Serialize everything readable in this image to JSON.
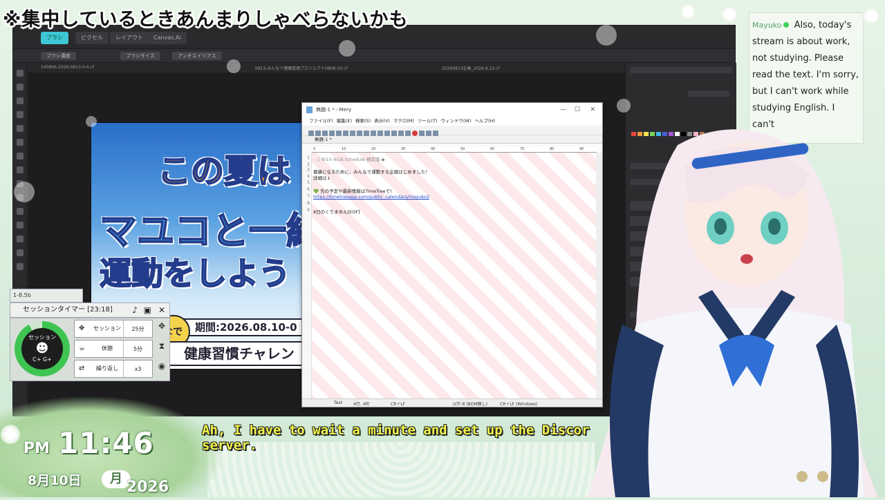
{
  "banner_text": "※集中しているときあんまりしゃべらないかも",
  "painter": {
    "tabs": [
      "ブラシ",
      "ピクセル",
      "レイアウト",
      "Canvas.Ai"
    ],
    "options": [
      "ブラシ濃度",
      "ブラシサイズ",
      "アンチエイリアス"
    ],
    "doc_tabs": [
      "240806-2026-0813-0-4.cf",
      "0813.みんなで健康管理プロジェクト0808-00.cf",
      "20260813企画_2026.8.10.cf"
    ],
    "swatch_colors": [
      "#e8453c",
      "#f19a3e",
      "#f6e24c",
      "#7ad15a",
      "#3cb4e5",
      "#4a60d8",
      "#a45ad6",
      "#ffffff",
      "#000000",
      "#888888",
      "#f6b8c8",
      "#b87b52"
    ]
  },
  "poster": {
    "line1": "この夏は",
    "line2": "マユコと一緒",
    "line3": "運動をしよう",
    "badge": "期間:2026.08.10-0",
    "sub": "健康習慣チャレン",
    "circle_text": "なで"
  },
  "mery": {
    "title": "無題-1 * - Mery",
    "menu": [
      "ファイル(F)",
      "編集(E)",
      "検索(S)",
      "表示(V)",
      "マクロ(M)",
      "ツール(T)",
      "ウィンドウ(W)",
      "ヘルプ(H)"
    ],
    "doc_tab": "無題-1 *",
    "ruler": [
      "0",
      "10",
      "20",
      "30",
      "40",
      "50",
      "60",
      "70",
      "80",
      "90"
    ],
    "line_numbers": [
      "1",
      "2",
      "3",
      "4",
      "5",
      "6",
      "7",
      "8",
      "9"
    ],
    "lines": [
      "- ○ 8/10-8/16 schedule 検定版 ◆",
      "",
      "健康になるために、みんなで運動する企画はじめました！",
      "詳細は↓",
      "",
      "💚 先の予定や最新情報はTimeTreeで！",
      "https://timetreeapp.com/public_calendars/mayuko2",
      "",
      "8日のくりまゆん[EOF]"
    ],
    "status": {
      "mode": "Text",
      "pos": "4行, 4桁",
      "eol": "CR＋LF",
      "encoding": "UTF-8 (BOM無し)",
      "eol2": "CR＋LF (Windows)"
    },
    "controls": {
      "min": "—",
      "max": "☐",
      "close": "✕"
    }
  },
  "timer": {
    "mini_label": "1-8.5b",
    "title": "セッションタイマー [23:18]",
    "ring_label": "セッション",
    "ring_icon": "C+ G+",
    "rows": [
      {
        "label": "セッション",
        "value": "25分",
        "icon": "move-icon"
      },
      {
        "label": "休憩",
        "value": "5分",
        "icon": "coffee-icon"
      },
      {
        "label": "繰り返し",
        "value": "x3",
        "icon": "repeat-icon"
      }
    ]
  },
  "chat": {
    "username": "Mayuko",
    "message": "Also, today's stream is about work, not studying. Please read the text. I'm sorry, but I can't work while studying English. I can't"
  },
  "clock": {
    "ampm": "PM",
    "time": "11:46",
    "date": "8月10日",
    "day": "月",
    "year": "2026"
  },
  "subtitle": "Ah, I have to wait a minute and set up the Discor server.",
  "colors": {
    "accent": "#3ec7d4",
    "subtitle": "#f1f54a",
    "timer_ring": "#3fc452",
    "chat_name": "#57a26a"
  }
}
